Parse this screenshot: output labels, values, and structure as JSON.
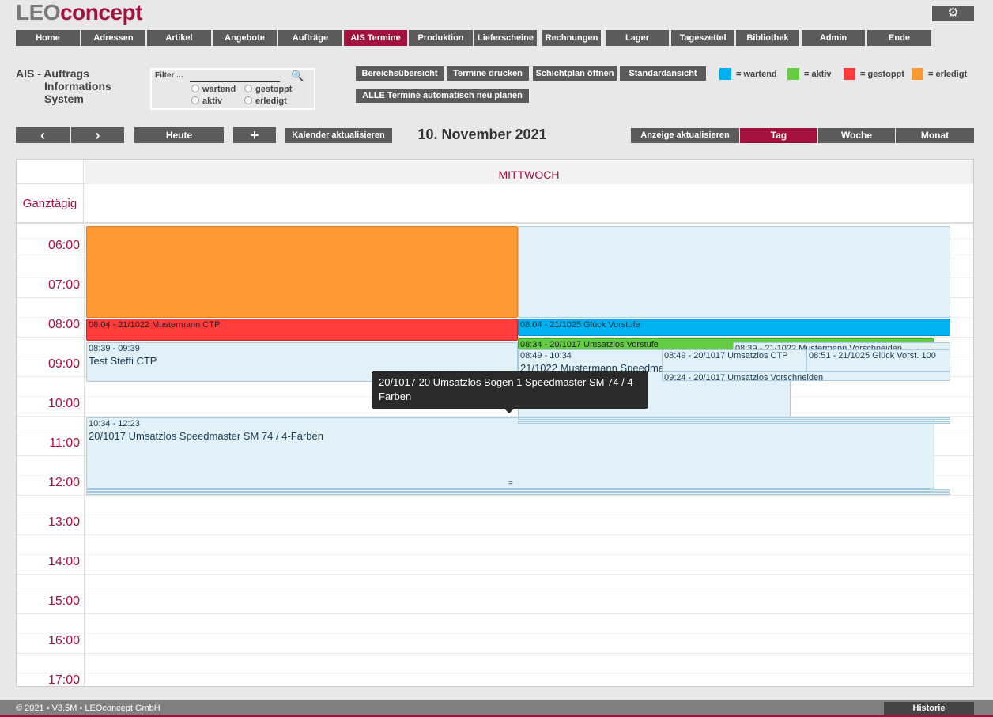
{
  "logo": {
    "part1": "LEO",
    "part2": "concept"
  },
  "settings_icon": "gear-icon",
  "nav": [
    {
      "label": "Home"
    },
    {
      "label": "Adressen"
    },
    {
      "label": "Artikel"
    },
    {
      "label": "Angebote"
    },
    {
      "label": "Aufträge"
    },
    {
      "label": "AIS Termine"
    },
    {
      "label": "Produktion"
    },
    {
      "label": "Lieferscheine"
    },
    {
      "label": "Rechnungen"
    },
    {
      "label": "Lager"
    },
    {
      "label": "Tageszettel"
    },
    {
      "label": "Bibliothek"
    },
    {
      "label": "Admin"
    },
    {
      "label": "Ende"
    }
  ],
  "active_nav": "AIS Termine",
  "ais": {
    "line1": "AIS - Auftrags",
    "line2": "Informations",
    "line3": "System"
  },
  "filter": {
    "label": "Filter ...",
    "value": "",
    "radios": [
      {
        "label": "wartend"
      },
      {
        "label": "gestoppt"
      },
      {
        "label": "aktiv"
      },
      {
        "label": "erledigt"
      }
    ]
  },
  "toolbar": {
    "bereich": "Bereichsübersicht",
    "drucken": "Termine drucken",
    "schicht": "Schichtplan öffnen",
    "standard": "Standardansicht",
    "neuplanen": "ALLE Termine automatisch neu planen"
  },
  "legend": [
    {
      "label": "= wartend",
      "color": "#00b0f0"
    },
    {
      "label": "= aktiv",
      "color": "#66cc44"
    },
    {
      "label": "= gestoppt",
      "color": "#ff3b3b"
    },
    {
      "label": "= erledigt",
      "color": "#ff9933"
    }
  ],
  "calnav": {
    "prev": "‹",
    "next": "›",
    "today": "Heute",
    "add": "+",
    "refresh_cal": "Kalender aktualisieren"
  },
  "date": "10. November 2021",
  "views": {
    "refresh": "Anzeige aktualisieren",
    "day": "Tag",
    "week": "Woche",
    "month": "Monat"
  },
  "calendar": {
    "day_header": "MITTWOCH",
    "allday_label": "Ganztägig",
    "hours": [
      "06:00",
      "07:00",
      "08:00",
      "09:00",
      "10:00",
      "11:00",
      "12:00",
      "13:00",
      "14:00",
      "15:00",
      "16:00",
      "17:00"
    ]
  },
  "events": {
    "e_red": "08:04 - 21/1022 Mustermann CTP",
    "e_blue": "08:04 - 21/1025 Glück Vorstufe",
    "e_green": "08:34 - 20/1017 Umsatzlos Vorstufe",
    "e_steffi_time": "08:39 - 09:39",
    "e_steffi_name": "Test Steffi CTP",
    "e_must2_time": "08:49 - 10:34",
    "e_must2_name": "21/1022 Mustermann Speedmaster",
    "e_umsatz_ctp": "08:49 - 20/1017 Umsatzlos CTP",
    "e_small1": "08:39 - 21/1022 Mustermann Vorschneiden",
    "e_small2": "08:51 - 21/1025 Glück Vorst. 100",
    "e_vorschneiden": "09:24 - 20/1017 Umsatzlos Vorschneiden",
    "e_main_time": "10:34 - 12:23",
    "e_main_name": "20/1017 Umsatzlos Speedmaster SM 74 / 4-Farben",
    "e_main_handle": "="
  },
  "tooltip": "20/1017 20 Umsatzlos Bogen 1 Speedmaster SM 74 / 4-Farben",
  "footer": {
    "copyright": "© 2021 • V3.5M • LEOconcept GmbH",
    "history": "Historie"
  }
}
